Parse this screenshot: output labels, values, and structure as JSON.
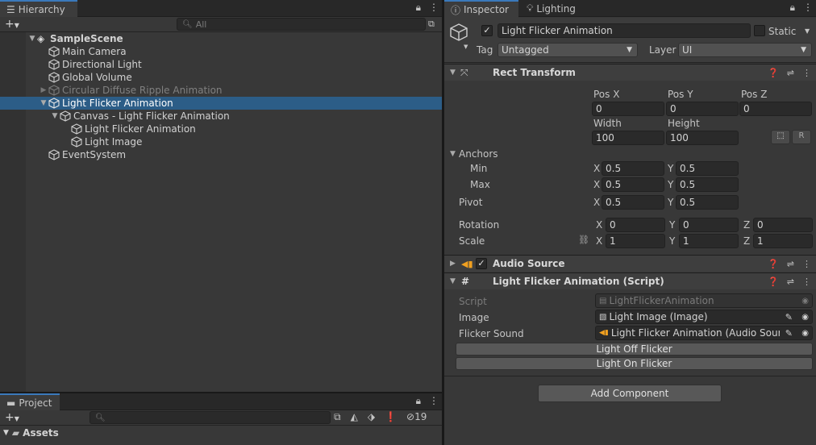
{
  "hierarchy": {
    "tab_label": "Hierarchy",
    "search_placeholder": "All",
    "scene": "SampleScene",
    "items": [
      {
        "label": "Main Camera"
      },
      {
        "label": "Directional Light"
      },
      {
        "label": "Global Volume"
      },
      {
        "label": "Circular Diffuse Ripple Animation"
      },
      {
        "label": "Light Flicker Animation"
      },
      {
        "label": "Canvas - Light Flicker Animation"
      },
      {
        "label": "Light Flicker Animation"
      },
      {
        "label": "Light Image"
      },
      {
        "label": "EventSystem"
      }
    ]
  },
  "project": {
    "tab_label": "Project",
    "hidden_count": "19",
    "assets_label": "Assets"
  },
  "inspector": {
    "tabs": [
      "Inspector",
      "Lighting"
    ],
    "object_name": "Light Flicker Animation",
    "static_label": "Static",
    "tag_label": "Tag",
    "tag_value": "Untagged",
    "layer_label": "Layer",
    "layer_value": "UI",
    "rect_transform": {
      "title": "Rect Transform",
      "pos_x_label": "Pos X",
      "pos_y_label": "Pos Y",
      "pos_z_label": "Pos Z",
      "pos_x": "0",
      "pos_y": "0",
      "pos_z": "0",
      "width_label": "Width",
      "height_label": "Height",
      "width": "100",
      "height": "100",
      "r_button": "R",
      "anchors_label": "Anchors",
      "min_label": "Min",
      "max_label": "Max",
      "pivot_label": "Pivot",
      "x_label": "X",
      "y_label": "Y",
      "z_label": "Z",
      "anchor_min_x": "0.5",
      "anchor_min_y": "0.5",
      "anchor_max_x": "0.5",
      "anchor_max_y": "0.5",
      "pivot_x": "0.5",
      "pivot_y": "0.5",
      "rotation_label": "Rotation",
      "rot_x": "0",
      "rot_y": "0",
      "rot_z": "0",
      "scale_label": "Scale",
      "scale_x": "1",
      "scale_y": "1",
      "scale_z": "1"
    },
    "audio_source": {
      "title": "Audio Source"
    },
    "script_component": {
      "title": "Light Flicker Animation (Script)",
      "script_label": "Script",
      "script_value": "LightFlickerAnimation",
      "image_label": "Image",
      "image_value": "Light Image (Image)",
      "flicker_label": "Flicker Sound",
      "flicker_value": "Light Flicker Animation (Audio Source",
      "off_button": "Light Off Flicker",
      "on_button": "Light On Flicker"
    },
    "add_component": "Add Component"
  },
  "colors": {
    "selection": "#2c5d87",
    "accent": "#3a79bb",
    "audio_icon": "#f0a020"
  }
}
